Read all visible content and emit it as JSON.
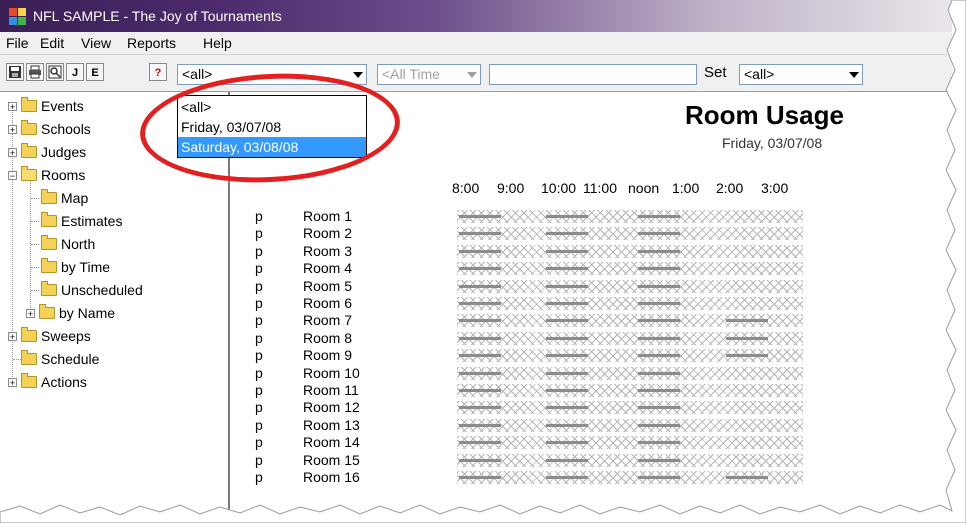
{
  "window": {
    "title": "NFL SAMPLE - The Joy of Tournaments"
  },
  "menu": [
    "File",
    "Edit",
    "View",
    "Reports",
    "Help"
  ],
  "toolbar": {
    "buttons": [
      "J",
      "E",
      "?"
    ],
    "event_filter": "<all>",
    "time_filter": "<All Time",
    "search_value": "",
    "set_label": "Set",
    "set_combo": "<all>"
  },
  "dropdown": {
    "options": [
      "<all>",
      "Friday, 03/07/08",
      "Saturday, 03/08/08"
    ],
    "selected": "Saturday, 03/08/08"
  },
  "tree": [
    {
      "label": "Events",
      "expander": "+"
    },
    {
      "label": "Schools",
      "expander": "+"
    },
    {
      "label": "Judges",
      "expander": "+"
    },
    {
      "label": "Rooms",
      "expander": "−"
    },
    {
      "label": "Map"
    },
    {
      "label": "Estimates"
    },
    {
      "label": "North"
    },
    {
      "label": "by Time"
    },
    {
      "label": "Unscheduled"
    },
    {
      "label": "by Name",
      "expander": "+"
    },
    {
      "label": "Sweeps",
      "expander": "+"
    },
    {
      "label": "Schedule"
    },
    {
      "label": "Actions",
      "expander": "+"
    }
  ],
  "report": {
    "title": "Room Usage",
    "date": "Friday, 03/07/08",
    "time_labels": [
      "8:00",
      "9:00",
      "10:00",
      "11:00",
      "noon",
      "1:00",
      "2:00",
      "3:00"
    ],
    "rooms": [
      {
        "flag": "p",
        "name": "Room 1",
        "slots": [
          1,
          0,
          1,
          0,
          1,
          0,
          0,
          0
        ]
      },
      {
        "flag": "p",
        "name": "Room 2",
        "slots": [
          1,
          0,
          1,
          0,
          1,
          0,
          0,
          0
        ]
      },
      {
        "flag": "p",
        "name": "Room 3",
        "slots": [
          1,
          0,
          1,
          0,
          1,
          0,
          0,
          0
        ]
      },
      {
        "flag": "p",
        "name": "Room 4",
        "slots": [
          1,
          0,
          1,
          0,
          1,
          0,
          0,
          0
        ]
      },
      {
        "flag": "p",
        "name": "Room 5",
        "slots": [
          1,
          0,
          1,
          0,
          1,
          0,
          0,
          0
        ]
      },
      {
        "flag": "p",
        "name": "Room 6",
        "slots": [
          1,
          0,
          1,
          0,
          1,
          0,
          0,
          0
        ]
      },
      {
        "flag": "p",
        "name": "Room 7",
        "slots": [
          1,
          0,
          1,
          0,
          1,
          0,
          1,
          0
        ]
      },
      {
        "flag": "p",
        "name": "Room 8",
        "slots": [
          1,
          0,
          1,
          0,
          1,
          0,
          1,
          0
        ]
      },
      {
        "flag": "p",
        "name": "Room 9",
        "slots": [
          1,
          0,
          1,
          0,
          1,
          0,
          1,
          0
        ]
      },
      {
        "flag": "p",
        "name": "Room 10",
        "slots": [
          1,
          0,
          1,
          0,
          1,
          0,
          0,
          0
        ]
      },
      {
        "flag": "p",
        "name": "Room 11",
        "slots": [
          1,
          0,
          1,
          0,
          1,
          0,
          0,
          0
        ]
      },
      {
        "flag": "p",
        "name": "Room 12",
        "slots": [
          1,
          0,
          1,
          0,
          1,
          0,
          0,
          0
        ]
      },
      {
        "flag": "p",
        "name": "Room 13",
        "slots": [
          1,
          0,
          1,
          0,
          1,
          0,
          0,
          0
        ]
      },
      {
        "flag": "p",
        "name": "Room 14",
        "slots": [
          1,
          0,
          1,
          0,
          1,
          0,
          0,
          0
        ]
      },
      {
        "flag": "p",
        "name": "Room 15",
        "slots": [
          1,
          0,
          1,
          0,
          1,
          0,
          0,
          0
        ]
      },
      {
        "flag": "p",
        "name": "Room 16",
        "slots": [
          1,
          0,
          1,
          0,
          1,
          0,
          1,
          0
        ]
      }
    ]
  },
  "colors": {
    "highlight": "#e32020",
    "selection": "#3399ff",
    "titlebar": "#4b2a6b"
  }
}
